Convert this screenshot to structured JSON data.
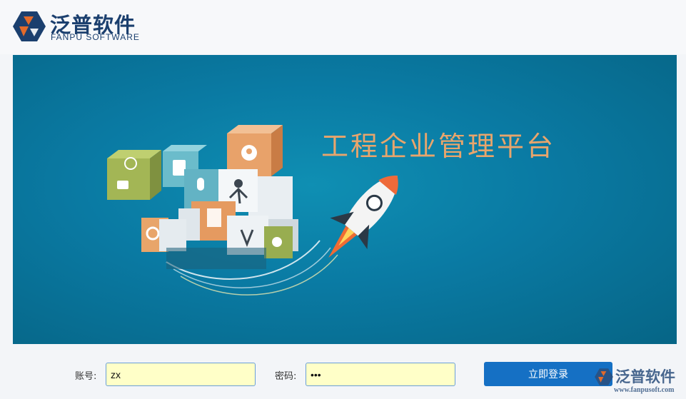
{
  "header": {
    "logo_cn": "泛普软件",
    "logo_en": "FANPU SOFTWARE",
    "logo_icon": "fanpu-logo-icon"
  },
  "banner": {
    "title": "工程企业管理平台",
    "art": "cube-and-rocket-illustration"
  },
  "login": {
    "username_label": "账号:",
    "username_value": "zx",
    "password_label": "密码:",
    "password_value": "zxc",
    "submit_label": "立即登录"
  },
  "watermark": {
    "cn": "泛普软件",
    "url": "www.fanpusoft.com"
  },
  "colors": {
    "brand_navy": "#1b3f6e",
    "brand_orange": "#e36a2a",
    "banner_teal": "#0a7aa3",
    "banner_title": "#e8a56c",
    "button_blue": "#1570c4",
    "input_bg": "#ffffc8",
    "input_border": "#6a9fd6"
  }
}
